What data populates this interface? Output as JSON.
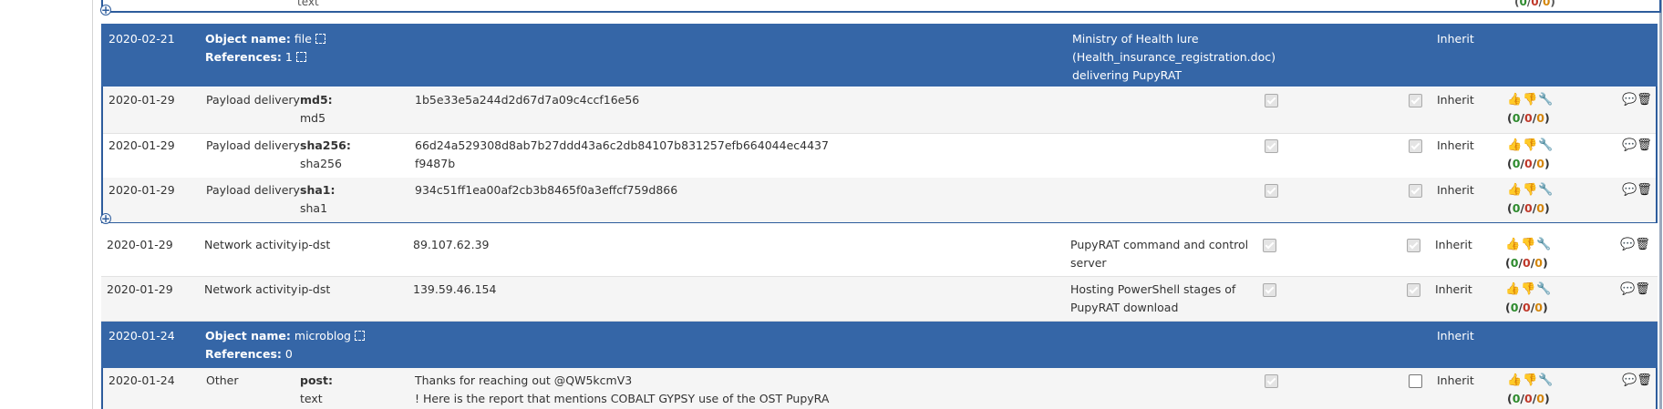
{
  "top_fragment": {
    "left": "text",
    "right_counts": {
      "g": "0",
      "r": "0",
      "o": "0"
    }
  },
  "objects": [
    {
      "date": "2020-02-21",
      "name_label": "Object name:",
      "name_value": "file",
      "refs_label": "References:",
      "refs_value": "1",
      "comment_lines": [
        "Ministry of Health lure",
        "(Health_insurance_registration.doc)",
        "delivering PupyRAT"
      ],
      "distribution": "Inherit"
    },
    {
      "date": "2020-01-24",
      "name_label": "Object name:",
      "name_value": "microblog",
      "refs_label": "References:",
      "refs_value": "0",
      "distribution": "Inherit"
    }
  ],
  "attributes": [
    {
      "date": "2020-01-29",
      "category": "Payload delivery",
      "type_bold": "md5:",
      "type_sub": "md5",
      "value_lines": [
        "1b5e33e5a244d2d67d7a09c4ccf16e56"
      ],
      "comment_lines": [],
      "ids": true,
      "corr": true,
      "distribution": "Inherit",
      "counts": {
        "g": "0",
        "r": "0",
        "o": "0"
      }
    },
    {
      "date": "2020-01-29",
      "category": "Payload delivery",
      "type_bold": "sha256:",
      "type_sub": "sha256",
      "value_lines": [
        "66d24a529308d8ab7b27ddd43a6c2db84107b831257efb664044ec4437",
        "f9487b"
      ],
      "comment_lines": [],
      "ids": true,
      "corr": true,
      "distribution": "Inherit",
      "counts": {
        "g": "0",
        "r": "0",
        "o": "0"
      }
    },
    {
      "date": "2020-01-29",
      "category": "Payload delivery",
      "type_bold": "sha1:",
      "type_sub": "sha1",
      "value_lines": [
        "934c51ff1ea00af2cb3b8465f0a3effcf759d866"
      ],
      "comment_lines": [],
      "ids": true,
      "corr": true,
      "distribution": "Inherit",
      "counts": {
        "g": "0",
        "r": "0",
        "o": "0"
      }
    },
    {
      "date": "2020-01-29",
      "category": "Network activity",
      "type_plain": "ip-dst",
      "value_lines": [
        "89.107.62.39"
      ],
      "comment_lines": [
        "PupyRAT command and control",
        "server"
      ],
      "ids": true,
      "corr": true,
      "distribution": "Inherit",
      "counts": {
        "g": "0",
        "r": "0",
        "o": "0"
      }
    },
    {
      "date": "2020-01-29",
      "category": "Network activity",
      "type_plain": "ip-dst",
      "value_lines": [
        "139.59.46.154"
      ],
      "comment_lines": [
        "Hosting PowerShell stages of",
        "PupyRAT download"
      ],
      "ids": true,
      "corr": true,
      "distribution": "Inherit",
      "counts": {
        "g": "0",
        "r": "0",
        "o": "0"
      }
    },
    {
      "date": "2020-01-24",
      "category": "Other",
      "type_bold": "post:",
      "type_sub": "text",
      "value_lines": [
        "Thanks for reaching out @QW5kcmV3",
        "! Here is the report that mentions COBALT GYPSY use of the OST PupyRA"
      ],
      "comment_lines": [],
      "ids": true,
      "corr": false,
      "distribution": "Inherit",
      "counts": {
        "g": "0",
        "r": "0",
        "o": "0"
      }
    }
  ],
  "icons": {
    "sighting_up": "thumbs-up-icon",
    "sighting_down": "thumbs-down-icon",
    "sighting_wrench": "wrench-icon",
    "discuss": "comment-icon",
    "delete": "trash-icon",
    "expand": "expand-icon",
    "collapse": "plus-circle-icon"
  },
  "colors": {
    "object_header": "#3566a7",
    "object_border": "#2d5c9c",
    "count_green": "#2e8b2e",
    "count_red": "#c0392b",
    "count_orange": "#d4860b"
  }
}
